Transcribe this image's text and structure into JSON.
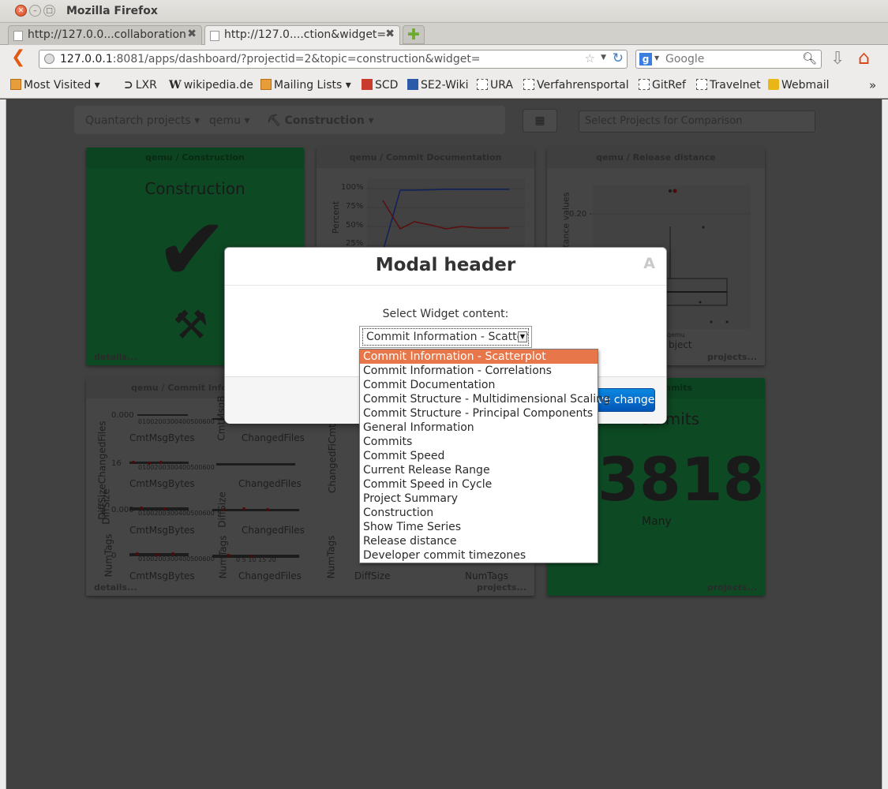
{
  "window": {
    "title": "Mozilla Firefox"
  },
  "tabs": [
    {
      "label": "http://127.0.0...collaboration"
    },
    {
      "label": "http://127.0....ction&widget="
    }
  ],
  "navbar": {
    "url_host": "127.0.0.1",
    "url_rest": ":8081/apps/dashboard/?projectid=2&topic=construction&widget=",
    "search_placeholder": "Google"
  },
  "bookmarks": [
    {
      "label": "Most Visited ▾",
      "icon": "folder"
    },
    {
      "label": "LXR",
      "icon": "lxr"
    },
    {
      "label": "wikipedia.de",
      "icon": "w"
    },
    {
      "label": "Mailing Lists ▾",
      "icon": "folder"
    },
    {
      "label": "SCD",
      "icon": "red"
    },
    {
      "label": "SE2-Wiki",
      "icon": "blue"
    },
    {
      "label": "URA",
      "icon": "dash"
    },
    {
      "label": "Verfahrensportal",
      "icon": "dash"
    },
    {
      "label": "GitRef",
      "icon": "dash"
    },
    {
      "label": "Travelnet",
      "icon": "dash"
    },
    {
      "label": "Webmail",
      "icon": "yellow"
    }
  ],
  "breadcrumb": {
    "projects": "Quantarch projects",
    "project": "qemu",
    "topic": "Construction"
  },
  "compare": {
    "placeholder": "Select Projects for Comparison"
  },
  "widgets": {
    "construction": {
      "header": "qemu / Construction",
      "title": "Construction",
      "footer": "details..."
    },
    "commit_doc": {
      "header": "qemu / Commit Documentation",
      "ylabel": "Percent",
      "ticks": [
        "100%",
        "75%",
        "50%",
        "25%"
      ]
    },
    "release": {
      "header": "qemu / Release distance",
      "ylabel": "stance values",
      "tick": "0.20 -",
      "xlabel_top": "qemu",
      "xlabel": "bject",
      "footer": "projects..."
    },
    "commit_info": {
      "header": "qemu / Commit Infor",
      "footer_left": "details...",
      "footer_right": "projects..."
    },
    "commits": {
      "header": "mmits",
      "title": "ommits",
      "value": "3818",
      "caption": "Many",
      "footer": "projects..."
    }
  },
  "scatter_labels": {
    "x1": "CmtMsgBytes",
    "x2": "ChangedFiles",
    "x3": "DiffSize",
    "x4": "NumTags",
    "y_diff": "DiffSizeChangedFiles",
    "y_diffsize": "DiffSize",
    "y_numtags": "NumTags",
    "y_cmt": "CmtMsgB",
    "y_changedf": "ChangedFiCmtM",
    "ticks_cmt": "0100200300400500600",
    "ticks_changed": "0  5  10  15  20",
    "ticks_small": "5  10  15  20",
    "val_small": "0.000",
    "val_16": "16",
    "val_0": "0"
  },
  "modal": {
    "title": "Modal header",
    "close": "A",
    "label": "Select Widget content:",
    "selected": "Commit Information - Scatterplot",
    "save_label": "Save changes"
  },
  "dropdown_options": [
    "Commit Information - Scatterplot",
    "Commit Information - Correlations",
    "Commit Documentation",
    "Commit Structure - Multidimensional Scaling",
    "Commit Structure - Principal Components",
    "General Information",
    "Commits",
    "Commit Speed",
    "Current Release Range",
    "Commit Speed in Cycle",
    "Project Summary",
    "Construction",
    "Show Time Series",
    "Release distance",
    "Developer commit timezones"
  ]
}
